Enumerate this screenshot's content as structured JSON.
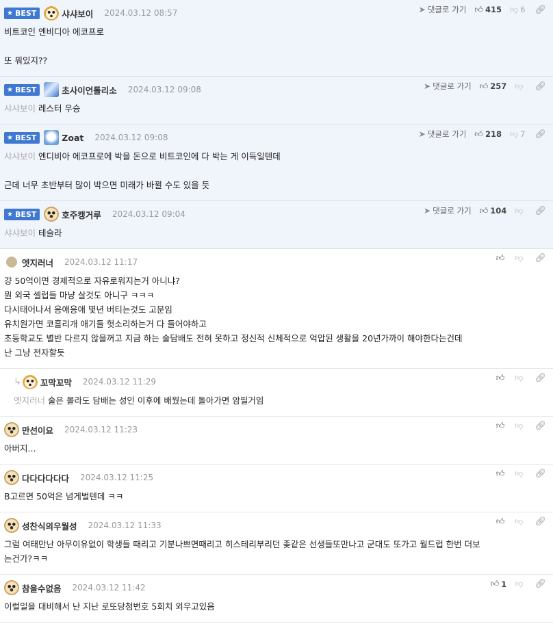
{
  "labels": {
    "best": "BEST",
    "go_reply": "댓글로 가기"
  },
  "comments": [
    {
      "best": true,
      "nick": "샤샤보이",
      "date": "2024.03.12 08:57",
      "avatar": "fox",
      "likes": "415",
      "dislikes": "6",
      "lines": [
        "비트코인 엔비디아 에코프로",
        "",
        "또 뭐있지??"
      ]
    },
    {
      "best": true,
      "nick": "초사이언톨리소",
      "date": "2024.03.12 09:08",
      "avatar": "blue",
      "likes": "257",
      "dislikes": "",
      "mention": "샤샤보이",
      "lines": [
        "레스터 우승"
      ]
    },
    {
      "best": true,
      "nick": "Zoat",
      "date": "2024.03.12 09:08",
      "avatar": "blue2",
      "likes": "218",
      "dislikes": "7",
      "mention": "샤샤보이",
      "lines": [
        "엔디비아 에코프로에 박을 돈으로 비트코인에 다 박는 게 이득일텐데",
        "",
        "근데 너무 초반부터 많이 박으면 미래가 바뀔 수도 있을 듯"
      ]
    },
    {
      "best": true,
      "nick": "호주캥거루",
      "date": "2024.03.12 09:04",
      "avatar": "dog",
      "likes": "104",
      "dislikes": "",
      "mention": "샤샤보이",
      "lines": [
        "테슬라"
      ]
    },
    {
      "best": false,
      "nick": "엣지러너",
      "date": "2024.03.12 11:17",
      "avatar": "plain",
      "likes": "",
      "dislikes": "",
      "lines": [
        "걍 50억이면 경제적으로 자유로워지는거 아니냐?",
        "뭔 외국 셀럽들 마냥 살것도 아니구 ㅋㅋㅋ",
        "다시태어나서 응애응애 몇년 버티는것도 고문임",
        "유치원가면 코흘리개 애기들 헛소리하는거 다 들어야하고",
        "초등학교도 별반 다르지 않을꺼고 지금 하는 술담배도 전혀 못하고 정신적 신체적으로 억압된 생활을 20년가까이 해야한다는건데",
        "난 그냥 전자할듯"
      ]
    },
    {
      "best": false,
      "reply": true,
      "nick": "꼬막꼬막",
      "date": "2024.03.12 11:29",
      "avatar": "fox",
      "likes": "",
      "dislikes": "",
      "mention": "엣지러너",
      "lines": [
        "술은 몰라도 담배는 성인 이후에 배웠는데 돌아가면 암필거임"
      ]
    },
    {
      "best": false,
      "nick": "만선이요",
      "date": "2024.03.12 11:23",
      "avatar": "dog",
      "likes": "",
      "dislikes": "",
      "lines": [
        "아버지..."
      ]
    },
    {
      "best": false,
      "nick": "다다다다다다",
      "date": "2024.03.12 11:25",
      "avatar": "dog",
      "likes": "",
      "dislikes": "",
      "lines": [
        "B고르면 50억은 넘게벌텐데 ㅋㅋ"
      ]
    },
    {
      "best": false,
      "nick": "성찬식의우월성",
      "date": "2024.03.12 11:33",
      "avatar": "dog",
      "likes": "",
      "dislikes": "",
      "lines": [
        "그럼 여태만난 아무이유없이 학생들 때리고 기분나쁘면때리고 히스테리부리던 좆같은 선생들또만나고 군대도 또가고 월드럽 한번 더보",
        "는건가?ㅋㅋ"
      ]
    },
    {
      "best": false,
      "nick": "참을수없음",
      "date": "2024.03.12 11:42",
      "avatar": "dog",
      "likes": "1",
      "dislikes": "",
      "lines": [
        "이럴일을 대비해서 난 지난 로또당첨번호 5회치 외우고있음"
      ]
    }
  ]
}
